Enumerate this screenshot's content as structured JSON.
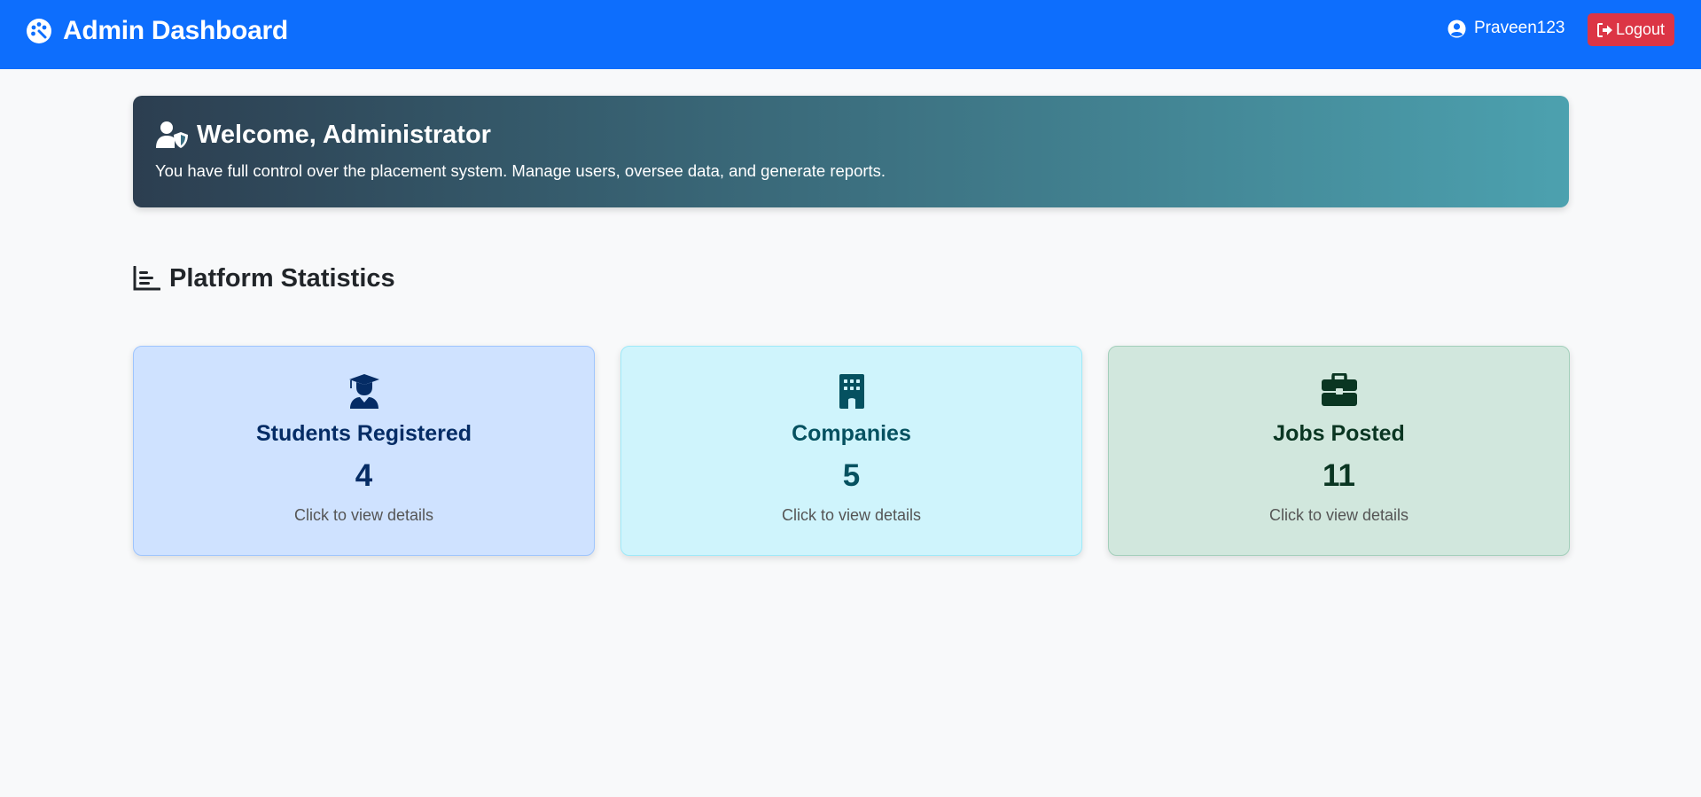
{
  "navbar": {
    "brand_icon": "palette-icon",
    "brand": "Admin Dashboard",
    "user_icon": "user-circle-icon",
    "username": "Praveen123",
    "logout_icon": "sign-out-icon",
    "logout_label": "Logout",
    "color": "#0d6efd",
    "logout_color": "#dc3545"
  },
  "welcome": {
    "icon": "user-shield-icon",
    "title": "Welcome, Administrator",
    "subtitle": "You have full control over the placement system. Manage users, oversee data, and generate reports.",
    "gradient_start": "#2c3e50",
    "gradient_end": "#4ca1af"
  },
  "stats": {
    "icon": "bar-chart-icon",
    "heading": "Platform Statistics",
    "cards": [
      {
        "icon": "graduate-icon",
        "title": "Students Registered",
        "value": "4",
        "hint": "Click to view details",
        "color": "#cfe2ff"
      },
      {
        "icon": "building-icon",
        "title": "Companies",
        "value": "5",
        "hint": "Click to view details",
        "color": "#cff4fc"
      },
      {
        "icon": "briefcase-icon",
        "title": "Jobs Posted",
        "value": "11",
        "hint": "Click to view details",
        "color": "#d1e7dd"
      }
    ]
  }
}
